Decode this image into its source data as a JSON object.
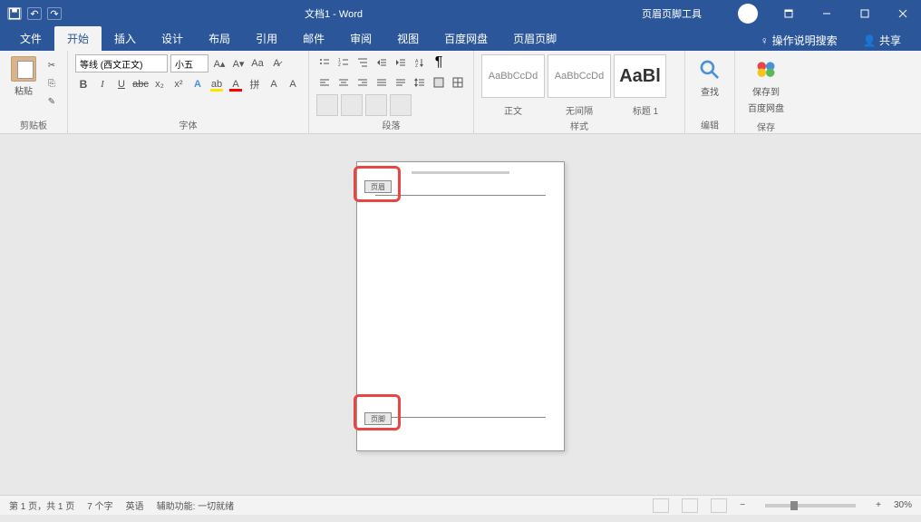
{
  "titlebar": {
    "doc": "文档1",
    "app": "Word",
    "tools": "页眉页脚工具"
  },
  "tabs": {
    "file": "文件",
    "home": "开始",
    "insert": "插入",
    "design": "设计",
    "layout": "布局",
    "references": "引用",
    "mailings": "邮件",
    "review": "审阅",
    "view": "视图",
    "baidu": "百度网盘",
    "hf_design": "页眉页脚",
    "tell_me": "操作说明搜索",
    "share": "共享"
  },
  "ribbon": {
    "clipboard_label": "剪贴板",
    "paste": "粘贴",
    "font_label": "字体",
    "font_name": "等线 (西文正文)",
    "font_size": "小五",
    "para_label": "段落",
    "styles_label": "样式",
    "style1_sample": "AaBbCcDd",
    "style2_sample": "AaBbCcDd",
    "style3_sample": "AaBl",
    "style1_name": "正文",
    "style2_name": "无间隔",
    "style3_name": "标题 1",
    "editing_label": "编辑",
    "find": "查找",
    "save_label": "保存",
    "save_to": "保存到",
    "save_to2": "百度网盘"
  },
  "page": {
    "header_tag": "页眉",
    "footer_tag": "页脚"
  },
  "status": {
    "page_info": "第 1 页，共 1 页",
    "words": "7 个字",
    "lang": "英语",
    "assist": "辅助功能: 一切就绪",
    "zoom": "30%"
  }
}
